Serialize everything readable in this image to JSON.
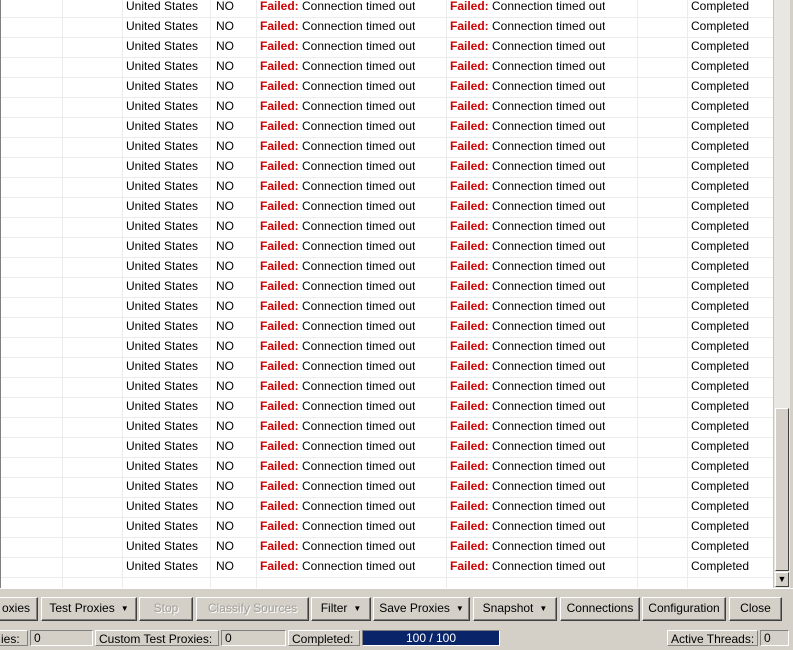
{
  "table": {
    "rows": [
      {
        "country": "United States",
        "anon": "NO",
        "fail1": "Failed:",
        "msg1": "Connection timed out",
        "fail2": "Failed:",
        "msg2": "Connection timed out",
        "status": "Completed"
      },
      {
        "country": "United States",
        "anon": "NO",
        "fail1": "Failed:",
        "msg1": "Connection timed out",
        "fail2": "Failed:",
        "msg2": "Connection timed out",
        "status": "Completed"
      },
      {
        "country": "United States",
        "anon": "NO",
        "fail1": "Failed:",
        "msg1": "Connection timed out",
        "fail2": "Failed:",
        "msg2": "Connection timed out",
        "status": "Completed"
      },
      {
        "country": "United States",
        "anon": "NO",
        "fail1": "Failed:",
        "msg1": "Connection timed out",
        "fail2": "Failed:",
        "msg2": "Connection timed out",
        "status": "Completed"
      },
      {
        "country": "United States",
        "anon": "NO",
        "fail1": "Failed:",
        "msg1": "Connection timed out",
        "fail2": "Failed:",
        "msg2": "Connection timed out",
        "status": "Completed"
      },
      {
        "country": "United States",
        "anon": "NO",
        "fail1": "Failed:",
        "msg1": "Connection timed out",
        "fail2": "Failed:",
        "msg2": "Connection timed out",
        "status": "Completed"
      },
      {
        "country": "United States",
        "anon": "NO",
        "fail1": "Failed:",
        "msg1": "Connection timed out",
        "fail2": "Failed:",
        "msg2": "Connection timed out",
        "status": "Completed"
      },
      {
        "country": "United States",
        "anon": "NO",
        "fail1": "Failed:",
        "msg1": "Connection timed out",
        "fail2": "Failed:",
        "msg2": "Connection timed out",
        "status": "Completed"
      },
      {
        "country": "United States",
        "anon": "NO",
        "fail1": "Failed:",
        "msg1": "Connection timed out",
        "fail2": "Failed:",
        "msg2": "Connection timed out",
        "status": "Completed"
      },
      {
        "country": "United States",
        "anon": "NO",
        "fail1": "Failed:",
        "msg1": "Connection timed out",
        "fail2": "Failed:",
        "msg2": "Connection timed out",
        "status": "Completed"
      },
      {
        "country": "United States",
        "anon": "NO",
        "fail1": "Failed:",
        "msg1": "Connection timed out",
        "fail2": "Failed:",
        "msg2": "Connection timed out",
        "status": "Completed"
      },
      {
        "country": "United States",
        "anon": "NO",
        "fail1": "Failed:",
        "msg1": "Connection timed out",
        "fail2": "Failed:",
        "msg2": "Connection timed out",
        "status": "Completed"
      },
      {
        "country": "United States",
        "anon": "NO",
        "fail1": "Failed:",
        "msg1": "Connection timed out",
        "fail2": "Failed:",
        "msg2": "Connection timed out",
        "status": "Completed"
      },
      {
        "country": "United States",
        "anon": "NO",
        "fail1": "Failed:",
        "msg1": "Connection timed out",
        "fail2": "Failed:",
        "msg2": "Connection timed out",
        "status": "Completed"
      },
      {
        "country": "United States",
        "anon": "NO",
        "fail1": "Failed:",
        "msg1": "Connection timed out",
        "fail2": "Failed:",
        "msg2": "Connection timed out",
        "status": "Completed"
      },
      {
        "country": "United States",
        "anon": "NO",
        "fail1": "Failed:",
        "msg1": "Connection timed out",
        "fail2": "Failed:",
        "msg2": "Connection timed out",
        "status": "Completed"
      },
      {
        "country": "United States",
        "anon": "NO",
        "fail1": "Failed:",
        "msg1": "Connection timed out",
        "fail2": "Failed:",
        "msg2": "Connection timed out",
        "status": "Completed"
      },
      {
        "country": "United States",
        "anon": "NO",
        "fail1": "Failed:",
        "msg1": "Connection timed out",
        "fail2": "Failed:",
        "msg2": "Connection timed out",
        "status": "Completed"
      },
      {
        "country": "United States",
        "anon": "NO",
        "fail1": "Failed:",
        "msg1": "Connection timed out",
        "fail2": "Failed:",
        "msg2": "Connection timed out",
        "status": "Completed"
      },
      {
        "country": "United States",
        "anon": "NO",
        "fail1": "Failed:",
        "msg1": "Connection timed out",
        "fail2": "Failed:",
        "msg2": "Connection timed out",
        "status": "Completed"
      },
      {
        "country": "United States",
        "anon": "NO",
        "fail1": "Failed:",
        "msg1": "Connection timed out",
        "fail2": "Failed:",
        "msg2": "Connection timed out",
        "status": "Completed"
      },
      {
        "country": "United States",
        "anon": "NO",
        "fail1": "Failed:",
        "msg1": "Connection timed out",
        "fail2": "Failed:",
        "msg2": "Connection timed out",
        "status": "Completed"
      },
      {
        "country": "United States",
        "anon": "NO",
        "fail1": "Failed:",
        "msg1": "Connection timed out",
        "fail2": "Failed:",
        "msg2": "Connection timed out",
        "status": "Completed"
      },
      {
        "country": "United States",
        "anon": "NO",
        "fail1": "Failed:",
        "msg1": "Connection timed out",
        "fail2": "Failed:",
        "msg2": "Connection timed out",
        "status": "Completed"
      },
      {
        "country": "United States",
        "anon": "NO",
        "fail1": "Failed:",
        "msg1": "Connection timed out",
        "fail2": "Failed:",
        "msg2": "Connection timed out",
        "status": "Completed"
      },
      {
        "country": "United States",
        "anon": "NO",
        "fail1": "Failed:",
        "msg1": "Connection timed out",
        "fail2": "Failed:",
        "msg2": "Connection timed out",
        "status": "Completed"
      },
      {
        "country": "United States",
        "anon": "NO",
        "fail1": "Failed:",
        "msg1": "Connection timed out",
        "fail2": "Failed:",
        "msg2": "Connection timed out",
        "status": "Completed"
      },
      {
        "country": "United States",
        "anon": "NO",
        "fail1": "Failed:",
        "msg1": "Connection timed out",
        "fail2": "Failed:",
        "msg2": "Connection timed out",
        "status": "Completed"
      },
      {
        "country": "United States",
        "anon": "NO",
        "fail1": "Failed:",
        "msg1": "Connection timed out",
        "fail2": "Failed:",
        "msg2": "Connection timed out",
        "status": "Completed"
      }
    ],
    "fail_color": "#cc0000"
  },
  "toolbar": {
    "load_label": "oxies",
    "test_label": "Test Proxies",
    "stop_label": "Stop",
    "classify_label": "Classify Sources",
    "filter_label": "Filter",
    "save_label": "Save Proxies",
    "snapshot_label": "Snapshot",
    "connections_label": "Connections",
    "configuration_label": "Configuration",
    "close_label": "Close",
    "dropdown_icon": "triangle-down-icon"
  },
  "status": {
    "proxies_label": "ies:",
    "proxies_value": "0",
    "custom_label": "Custom Test Proxies:",
    "custom_value": "0",
    "completed_label": "Completed:",
    "progress_text": "100 / 100",
    "progress_fraction": 1.0,
    "threads_label": "Active Threads:",
    "threads_value": "0",
    "progress_color": "#0a246a"
  }
}
